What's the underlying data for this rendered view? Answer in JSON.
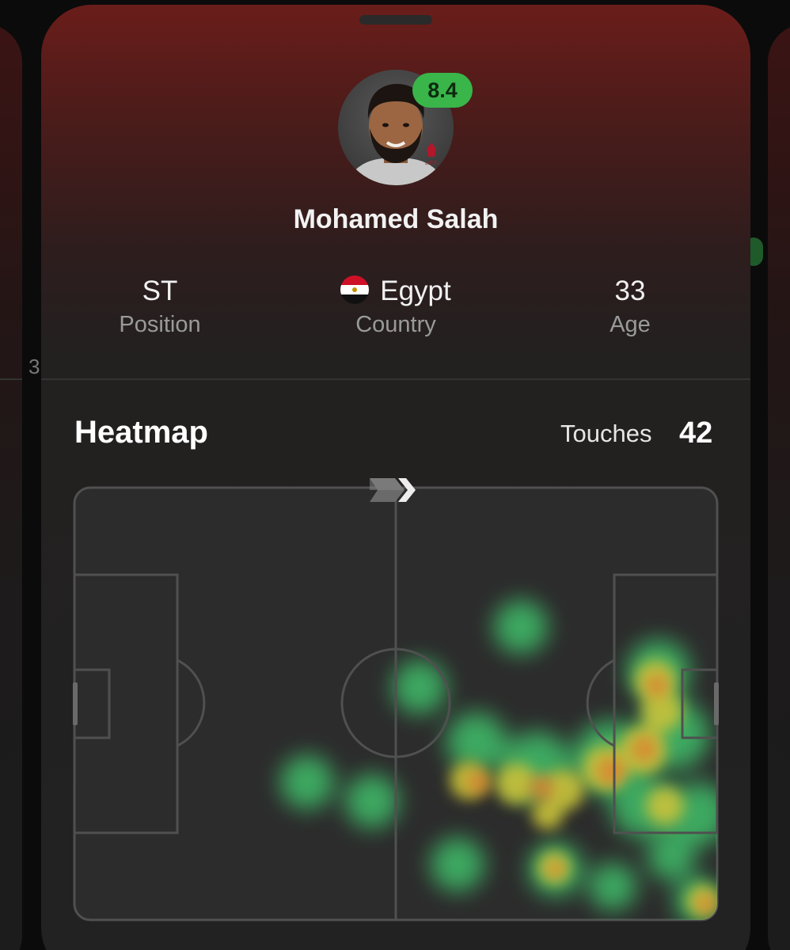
{
  "player": {
    "name": "Mohamed Salah",
    "rating": "8.4",
    "avatar_icon": "player-avatar",
    "club_crest_icon": "liverpool-crest-icon"
  },
  "info": {
    "position": {
      "value": "ST",
      "label": "Position"
    },
    "country": {
      "value": "Egypt",
      "label": "Country",
      "flag_icon": "egypt-flag-icon"
    },
    "age": {
      "value": "33",
      "label": "Age"
    }
  },
  "heatmap": {
    "title": "Heatmap",
    "touches_label": "Touches",
    "touches_value": "42",
    "direction_icon": "attack-direction-chevrons-icon"
  },
  "colors": {
    "rating_badge": "#39b54a",
    "card_top": "#6a1d1a",
    "card_body": "#222222",
    "pitch_lines": "#505050",
    "heat_low": "#3fbf6a",
    "heat_mid": "#c9c23a",
    "heat_high": "#e07b2f"
  },
  "background": {
    "left_card_text": "3"
  }
}
